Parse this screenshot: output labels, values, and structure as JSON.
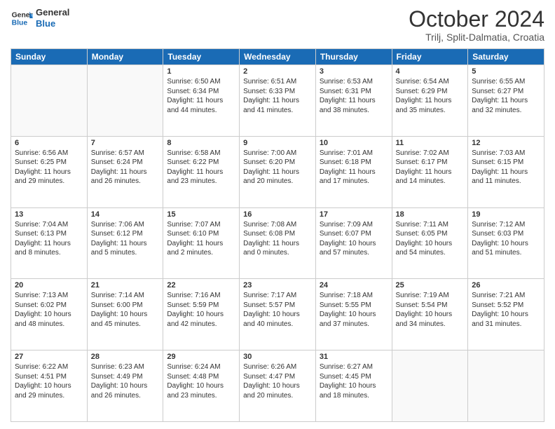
{
  "header": {
    "logo_line1": "General",
    "logo_line2": "Blue",
    "month": "October 2024",
    "location": "Trilj, Split-Dalmatia, Croatia"
  },
  "days_of_week": [
    "Sunday",
    "Monday",
    "Tuesday",
    "Wednesday",
    "Thursday",
    "Friday",
    "Saturday"
  ],
  "weeks": [
    [
      {
        "day": "",
        "lines": []
      },
      {
        "day": "",
        "lines": []
      },
      {
        "day": "1",
        "lines": [
          "Sunrise: 6:50 AM",
          "Sunset: 6:34 PM",
          "Daylight: 11 hours",
          "and 44 minutes."
        ]
      },
      {
        "day": "2",
        "lines": [
          "Sunrise: 6:51 AM",
          "Sunset: 6:33 PM",
          "Daylight: 11 hours",
          "and 41 minutes."
        ]
      },
      {
        "day": "3",
        "lines": [
          "Sunrise: 6:53 AM",
          "Sunset: 6:31 PM",
          "Daylight: 11 hours",
          "and 38 minutes."
        ]
      },
      {
        "day": "4",
        "lines": [
          "Sunrise: 6:54 AM",
          "Sunset: 6:29 PM",
          "Daylight: 11 hours",
          "and 35 minutes."
        ]
      },
      {
        "day": "5",
        "lines": [
          "Sunrise: 6:55 AM",
          "Sunset: 6:27 PM",
          "Daylight: 11 hours",
          "and 32 minutes."
        ]
      }
    ],
    [
      {
        "day": "6",
        "lines": [
          "Sunrise: 6:56 AM",
          "Sunset: 6:25 PM",
          "Daylight: 11 hours",
          "and 29 minutes."
        ]
      },
      {
        "day": "7",
        "lines": [
          "Sunrise: 6:57 AM",
          "Sunset: 6:24 PM",
          "Daylight: 11 hours",
          "and 26 minutes."
        ]
      },
      {
        "day": "8",
        "lines": [
          "Sunrise: 6:58 AM",
          "Sunset: 6:22 PM",
          "Daylight: 11 hours",
          "and 23 minutes."
        ]
      },
      {
        "day": "9",
        "lines": [
          "Sunrise: 7:00 AM",
          "Sunset: 6:20 PM",
          "Daylight: 11 hours",
          "and 20 minutes."
        ]
      },
      {
        "day": "10",
        "lines": [
          "Sunrise: 7:01 AM",
          "Sunset: 6:18 PM",
          "Daylight: 11 hours",
          "and 17 minutes."
        ]
      },
      {
        "day": "11",
        "lines": [
          "Sunrise: 7:02 AM",
          "Sunset: 6:17 PM",
          "Daylight: 11 hours",
          "and 14 minutes."
        ]
      },
      {
        "day": "12",
        "lines": [
          "Sunrise: 7:03 AM",
          "Sunset: 6:15 PM",
          "Daylight: 11 hours",
          "and 11 minutes."
        ]
      }
    ],
    [
      {
        "day": "13",
        "lines": [
          "Sunrise: 7:04 AM",
          "Sunset: 6:13 PM",
          "Daylight: 11 hours",
          "and 8 minutes."
        ]
      },
      {
        "day": "14",
        "lines": [
          "Sunrise: 7:06 AM",
          "Sunset: 6:12 PM",
          "Daylight: 11 hours",
          "and 5 minutes."
        ]
      },
      {
        "day": "15",
        "lines": [
          "Sunrise: 7:07 AM",
          "Sunset: 6:10 PM",
          "Daylight: 11 hours",
          "and 2 minutes."
        ]
      },
      {
        "day": "16",
        "lines": [
          "Sunrise: 7:08 AM",
          "Sunset: 6:08 PM",
          "Daylight: 11 hours",
          "and 0 minutes."
        ]
      },
      {
        "day": "17",
        "lines": [
          "Sunrise: 7:09 AM",
          "Sunset: 6:07 PM",
          "Daylight: 10 hours",
          "and 57 minutes."
        ]
      },
      {
        "day": "18",
        "lines": [
          "Sunrise: 7:11 AM",
          "Sunset: 6:05 PM",
          "Daylight: 10 hours",
          "and 54 minutes."
        ]
      },
      {
        "day": "19",
        "lines": [
          "Sunrise: 7:12 AM",
          "Sunset: 6:03 PM",
          "Daylight: 10 hours",
          "and 51 minutes."
        ]
      }
    ],
    [
      {
        "day": "20",
        "lines": [
          "Sunrise: 7:13 AM",
          "Sunset: 6:02 PM",
          "Daylight: 10 hours",
          "and 48 minutes."
        ]
      },
      {
        "day": "21",
        "lines": [
          "Sunrise: 7:14 AM",
          "Sunset: 6:00 PM",
          "Daylight: 10 hours",
          "and 45 minutes."
        ]
      },
      {
        "day": "22",
        "lines": [
          "Sunrise: 7:16 AM",
          "Sunset: 5:59 PM",
          "Daylight: 10 hours",
          "and 42 minutes."
        ]
      },
      {
        "day": "23",
        "lines": [
          "Sunrise: 7:17 AM",
          "Sunset: 5:57 PM",
          "Daylight: 10 hours",
          "and 40 minutes."
        ]
      },
      {
        "day": "24",
        "lines": [
          "Sunrise: 7:18 AM",
          "Sunset: 5:55 PM",
          "Daylight: 10 hours",
          "and 37 minutes."
        ]
      },
      {
        "day": "25",
        "lines": [
          "Sunrise: 7:19 AM",
          "Sunset: 5:54 PM",
          "Daylight: 10 hours",
          "and 34 minutes."
        ]
      },
      {
        "day": "26",
        "lines": [
          "Sunrise: 7:21 AM",
          "Sunset: 5:52 PM",
          "Daylight: 10 hours",
          "and 31 minutes."
        ]
      }
    ],
    [
      {
        "day": "27",
        "lines": [
          "Sunrise: 6:22 AM",
          "Sunset: 4:51 PM",
          "Daylight: 10 hours",
          "and 29 minutes."
        ]
      },
      {
        "day": "28",
        "lines": [
          "Sunrise: 6:23 AM",
          "Sunset: 4:49 PM",
          "Daylight: 10 hours",
          "and 26 minutes."
        ]
      },
      {
        "day": "29",
        "lines": [
          "Sunrise: 6:24 AM",
          "Sunset: 4:48 PM",
          "Daylight: 10 hours",
          "and 23 minutes."
        ]
      },
      {
        "day": "30",
        "lines": [
          "Sunrise: 6:26 AM",
          "Sunset: 4:47 PM",
          "Daylight: 10 hours",
          "and 20 minutes."
        ]
      },
      {
        "day": "31",
        "lines": [
          "Sunrise: 6:27 AM",
          "Sunset: 4:45 PM",
          "Daylight: 10 hours",
          "and 18 minutes."
        ]
      },
      {
        "day": "",
        "lines": []
      },
      {
        "day": "",
        "lines": []
      }
    ]
  ]
}
